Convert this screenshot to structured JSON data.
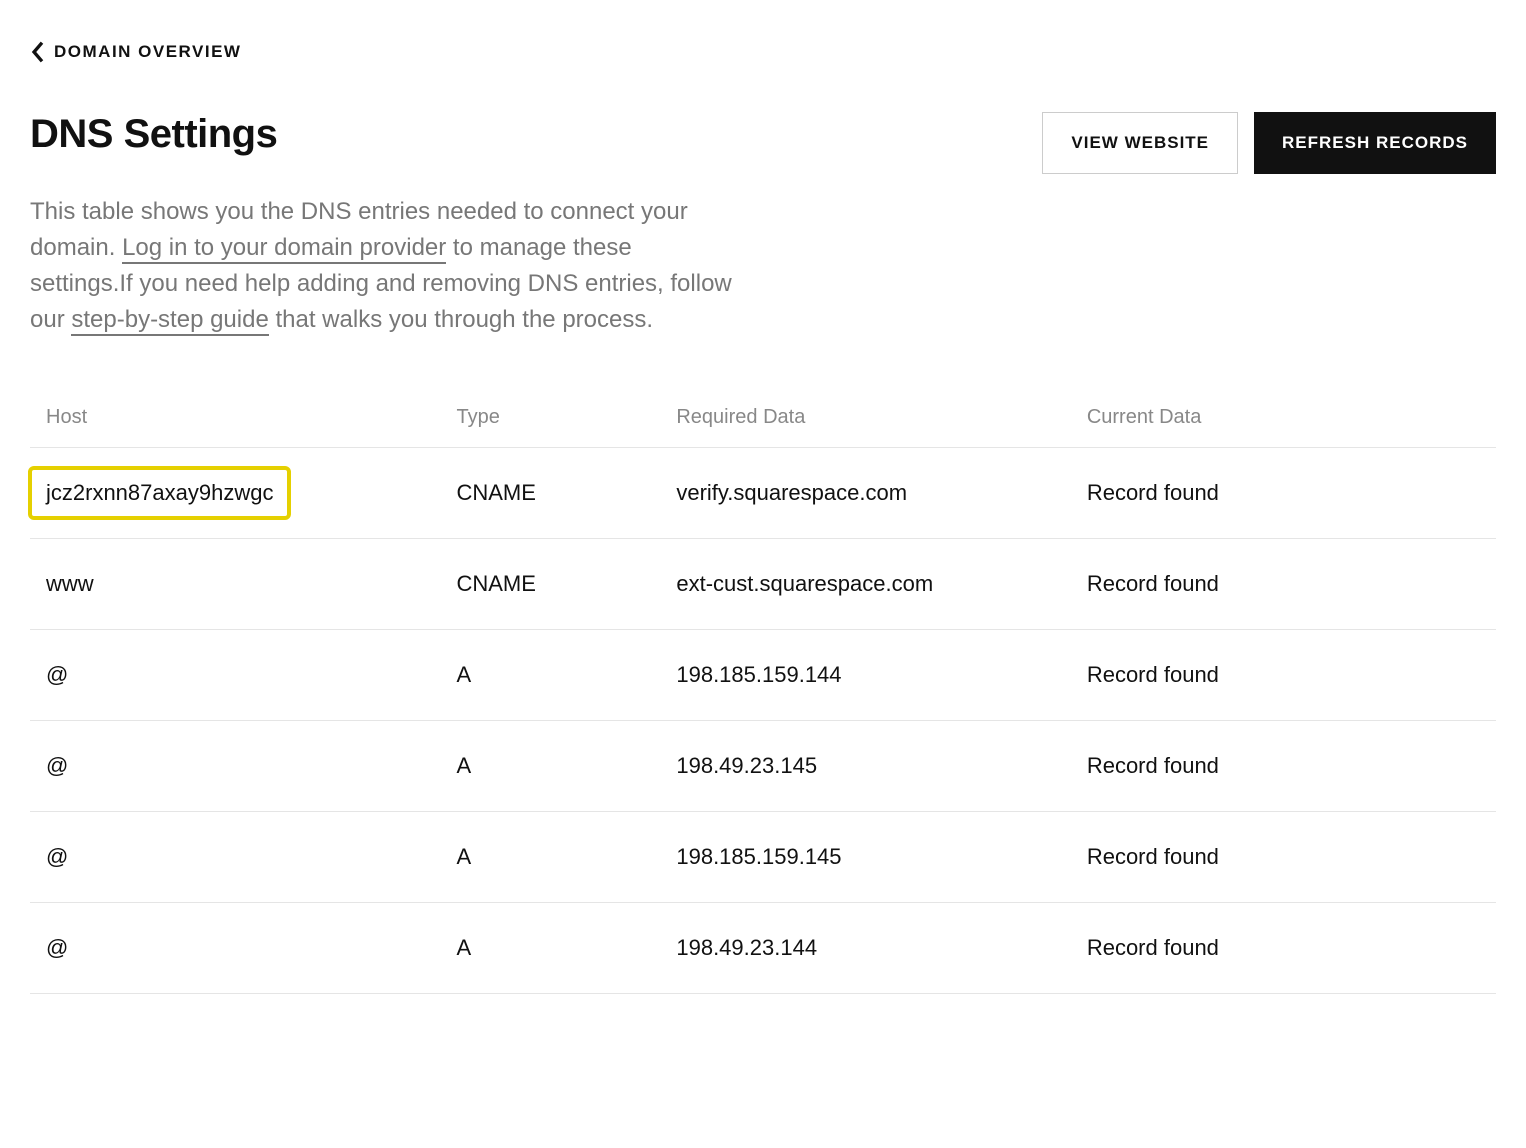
{
  "breadcrumb": {
    "label": "DOMAIN OVERVIEW"
  },
  "header": {
    "title": "DNS Settings",
    "view_website_label": "VIEW WEBSITE",
    "refresh_records_label": "REFRESH RECORDS"
  },
  "description": {
    "text_before_link1": "This table shows you the DNS entries needed to connect your domain. ",
    "link1_text": "Log in to your domain provider",
    "text_between": " to manage these settings.If you need help adding and removing DNS entries, follow our ",
    "link2_text": "step-by-step guide",
    "text_after": " that walks you through the process."
  },
  "table": {
    "headers": {
      "host": "Host",
      "type": "Type",
      "required_data": "Required Data",
      "current_data": "Current Data"
    },
    "rows": [
      {
        "host": "jcz2rxnn87axay9hzwgc",
        "type": "CNAME",
        "required_data": "verify.squarespace.com",
        "current_data": "Record found",
        "highlighted": true
      },
      {
        "host": "www",
        "type": "CNAME",
        "required_data": "ext-cust.squarespace.com",
        "current_data": "Record found",
        "highlighted": false
      },
      {
        "host": "@",
        "type": "A",
        "required_data": "198.185.159.144",
        "current_data": "Record found",
        "highlighted": false
      },
      {
        "host": "@",
        "type": "A",
        "required_data": "198.49.23.145",
        "current_data": "Record found",
        "highlighted": false
      },
      {
        "host": "@",
        "type": "A",
        "required_data": "198.185.159.145",
        "current_data": "Record found",
        "highlighted": false
      },
      {
        "host": "@",
        "type": "A",
        "required_data": "198.49.23.144",
        "current_data": "Record found",
        "highlighted": false
      }
    ]
  }
}
